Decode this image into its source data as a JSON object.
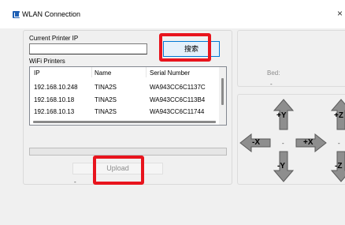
{
  "window": {
    "title": "WLAN Connection",
    "close_glyph": "×",
    "icon": "app-icon"
  },
  "connection": {
    "current_ip_label": "Current Printer IP",
    "current_ip_value": "",
    "search_button_label": "搜索",
    "wifi_printers_label": "WiFi Printers",
    "columns": [
      "IP",
      "Name",
      "Serial Number"
    ],
    "printers": [
      {
        "ip": "192.168.10.248",
        "name": "TINA2S",
        "serial": "WA943CC6C1137C"
      },
      {
        "ip": "192.168.10.18",
        "name": "TINA2S",
        "serial": "WA943CC6C113B4"
      },
      {
        "ip": "192.168.10.13",
        "name": "TINA2S",
        "serial": "WA943CC6C11744"
      }
    ],
    "progress": 0,
    "upload_button_label": "Upload",
    "status_text": "-"
  },
  "status": {
    "bed_label": "Bed:",
    "bed_value": "-"
  },
  "jog": {
    "plus_y": "+Y",
    "minus_y": "-Y",
    "minus_x": "-X",
    "plus_x": "+X",
    "plus_z": "+Z",
    "minus_z": "-Z",
    "center_dot": "-",
    "z_dot": "-"
  },
  "colors": {
    "highlight_box": "#e8141d",
    "accent_border": "#0078d4"
  }
}
